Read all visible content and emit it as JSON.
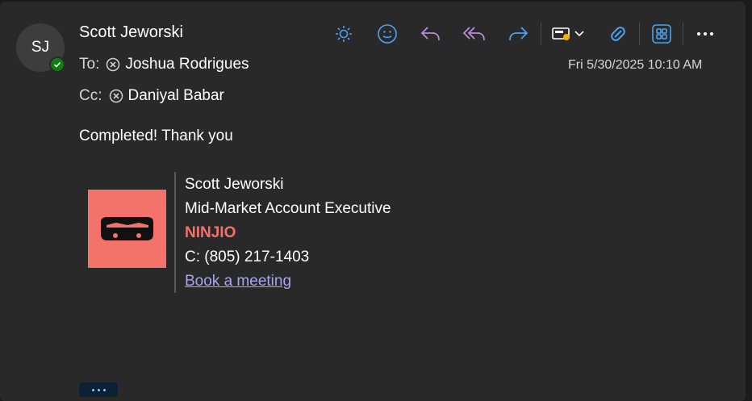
{
  "message": {
    "avatar_initials": "SJ",
    "sender": "Scott Jeworski",
    "to_label": "To:",
    "to_name": "Joshua Rodrigues",
    "cc_label": "Cc:",
    "cc_name": "Daniyal Babar",
    "datetime": "Fri 5/30/2025 10:10 AM",
    "body": "Completed! Thank you"
  },
  "signature": {
    "name": "Scott Jeworski",
    "title": "Mid-Market Account Executive",
    "company": "NINJIO",
    "phone": "C: (805) 217-1403",
    "link": "Book a meeting",
    "logo_color": "#f3726a"
  },
  "toolbar": {
    "icons": [
      "sun-icon",
      "smiley-icon",
      "reply-icon",
      "reply-all-icon",
      "forward-icon",
      "card-icon",
      "chevron-down-icon",
      "tag-icon",
      "apps-icon",
      "more-icon"
    ]
  },
  "colors": {
    "accent_blue": "#4aa3f0",
    "accent_purple": "#b98bdc",
    "presence_green": "#107c10"
  }
}
